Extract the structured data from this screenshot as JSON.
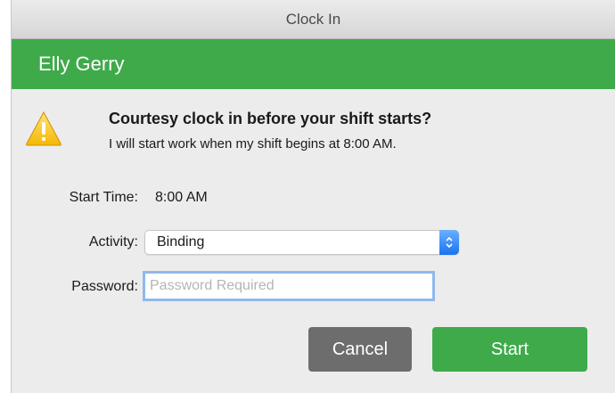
{
  "window": {
    "title": "Clock In"
  },
  "user": {
    "name": "Elly Gerry"
  },
  "alert": {
    "icon": "warning-icon",
    "title": "Courtesy clock in before your shift starts?",
    "message": "I will start work when my shift begins at 8:00 AM."
  },
  "form": {
    "start_time_label": "Start Time:",
    "start_time_value": "8:00 AM",
    "activity_label": "Activity:",
    "activity_value": "Binding",
    "password_label": "Password:",
    "password_placeholder": "Password Required",
    "password_value": ""
  },
  "buttons": {
    "cancel": "Cancel",
    "start": "Start"
  },
  "colors": {
    "accent": "#3faa4a",
    "cancel": "#6d6d6d",
    "focus": "#8fb9ec"
  }
}
